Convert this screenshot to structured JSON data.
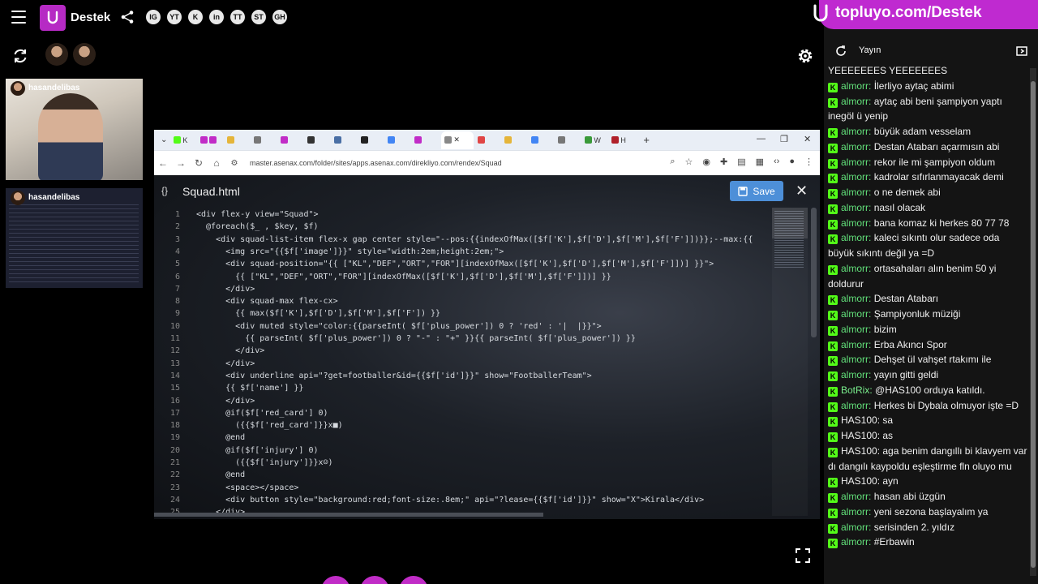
{
  "app": {
    "brand": "Destek"
  },
  "socials": [
    "IG",
    "YT",
    "K",
    "in",
    "TT",
    "ST",
    "GH"
  ],
  "cams": [
    {
      "name": "hasandelibas"
    },
    {
      "name": "hasandelibas"
    }
  ],
  "browser": {
    "url": "master.asenax.com/folder/sites/apps.asenax.com/direkliyo.com/rendex/Squad",
    "tabs": [
      "K",
      "",
      "",
      "",
      "",
      "",
      "",
      "",
      "",
      "",
      "",
      "",
      "",
      "",
      "W",
      "H"
    ]
  },
  "editor": {
    "filename": "Squad.html",
    "save_label": "Save",
    "lines": [
      {
        "n": "1",
        "t": "<div flex-y view=\"Squad\">"
      },
      {
        "n": "2",
        "t": "  @foreach($_ , $key, $f)"
      },
      {
        "n": "3",
        "t": "    <div squad-list-item flex-x gap center style=\"--pos:{{indexOfMax([$f['K'],$f['D'],$f['M'],$f['F']])}};--max:{{"
      },
      {
        "n": "4",
        "t": "      <img src=\"{{$f['image']}}\" style=\"width:2em;height:2em;\">"
      },
      {
        "n": "5",
        "t": "      <div squad-position=\"{{ [\"KL\",\"DEF\",\"ORT\",\"FOR\"][indexOfMax([$f['K'],$f['D'],$f['M'],$f['F']])] }}\">"
      },
      {
        "n": "6",
        "t": "        {{ [\"KL\",\"DEF\",\"ORT\",\"FOR\"][indexOfMax([$f['K'],$f['D'],$f['M'],$f['F']])] }}"
      },
      {
        "n": "7",
        "t": "      </div>"
      },
      {
        "n": "8",
        "t": "      <div squad-max flex-cx>"
      },
      {
        "n": "9",
        "t": "        {{ max($f['K'],$f['D'],$f['M'],$f['F']) }}"
      },
      {
        "n": "10",
        "t": "        <div muted style=\"color:{{parseInt( $f['plus_power']) 0 ? 'red' : '|  |}}\">"
      },
      {
        "n": "11",
        "t": "          {{ parseInt( $f['plus_power']) 0 ? \"-\" : \"+\" }}{{ parseInt( $f['plus_power']) }}"
      },
      {
        "n": "12",
        "t": "        </div>"
      },
      {
        "n": "13",
        "t": "      </div>"
      },
      {
        "n": "14",
        "t": "      <div underline api=\"?get=footballer&id={{$f['id']}}\" show=\"FootballerTeam\">"
      },
      {
        "n": "15",
        "t": "      {{ $f['name'] }}"
      },
      {
        "n": "16",
        "t": "      </div>"
      },
      {
        "n": "17",
        "t": "      @if($f['red_card'] 0)"
      },
      {
        "n": "18",
        "t": "        ({{$f['red_card']}}x■)"
      },
      {
        "n": "19",
        "t": "      @end"
      },
      {
        "n": "20",
        "t": "      @if($f['injury'] 0)"
      },
      {
        "n": "21",
        "t": "        ({{$f['injury']}}x☺)"
      },
      {
        "n": "22",
        "t": "      @end"
      },
      {
        "n": "23",
        "t": "      <space></space>"
      },
      {
        "n": "24",
        "t": "      <div button style=\"background:red;font-size:.8em;\" api=\"?lease={{$f['id']}}\" show=\"X\">Kirala</div>"
      },
      {
        "n": "25",
        "t": "    </div>"
      }
    ]
  },
  "chat": {
    "promo": "topluyo.com/Destek",
    "title": "Yayın",
    "messages": [
      {
        "user": "",
        "text": "YEEEEEEES YEEEEEEES"
      },
      {
        "user": "almorr:",
        "text": "İlerliyo aytaç abimi"
      },
      {
        "user": "almorr:",
        "text": "aytaç abi beni şampiyon yaptı inegöl ü yenip"
      },
      {
        "user": "almorr:",
        "text": "büyük adam vesselam"
      },
      {
        "user": "almorr:",
        "text": "Destan Atabarı açarmısın abi"
      },
      {
        "user": "almorr:",
        "text": "rekor ile mi şampiyon oldum"
      },
      {
        "user": "almorr:",
        "text": "kadrolar sıfırlanmayacak demi"
      },
      {
        "user": "almorr:",
        "text": "o ne demek abi"
      },
      {
        "user": "almorr:",
        "text": "nasıl olacak"
      },
      {
        "user": "almorr:",
        "text": "bana komaz ki herkes 80 77 78"
      },
      {
        "user": "almorr:",
        "text": "kaleci sıkıntı olur sadece oda büyük sıkıntı değil ya =D"
      },
      {
        "user": "almorr:",
        "text": "ortasahaları alın benim 50 yi doldurur"
      },
      {
        "user": "almorr:",
        "text": "Destan Atabarı"
      },
      {
        "user": "almorr:",
        "text": "Şampiyonluk müziği"
      },
      {
        "user": "almorr:",
        "text": "bizim"
      },
      {
        "user": "almorr:",
        "text": "Erba Akıncı Spor"
      },
      {
        "user": "almorr:",
        "text": "Dehşet ül vahşet rtakımı ile"
      },
      {
        "user": "almorr:",
        "text": "yayın gitti geldi"
      },
      {
        "user": "BotRix:",
        "text": "@HAS100 orduya katıldı."
      },
      {
        "user": "almorr:",
        "text": "Herkes bi Dybala olmuyor işte =D"
      },
      {
        "user": "HAS100:",
        "text": "sa"
      },
      {
        "user": "HAS100:",
        "text": "as"
      },
      {
        "user": "HAS100:",
        "text": "aga benim dangıllı bi klavyem var dı dangılı kaypoldu eşleştirme fln oluyo mu"
      },
      {
        "user": "HAS100:",
        "text": "ayn"
      },
      {
        "user": "almorr:",
        "text": "hasan abi üzgün"
      },
      {
        "user": "almorr:",
        "text": "yeni sezona başlayalım ya"
      },
      {
        "user": "almorr:",
        "text": "serisinden 2. yıldız"
      },
      {
        "user": "almorr:",
        "text": "#Erbawin"
      }
    ]
  },
  "colors": {
    "brand": "#b62ac4",
    "promo": "#bf2ad0",
    "save": "#4d8fd8",
    "kick": "#53fc18",
    "chat_user": "#62e07a"
  }
}
